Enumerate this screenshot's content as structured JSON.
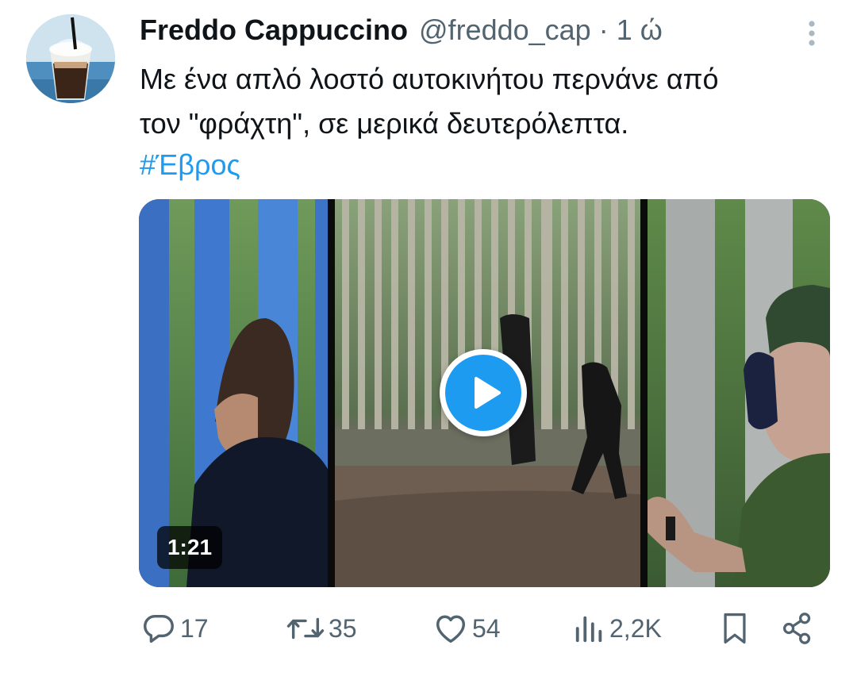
{
  "tweet": {
    "display_name": "Freddo Cappuccino",
    "handle": "@freddo_cap",
    "separator": "·",
    "time": "1 ώ",
    "text_lines": [
      "Με ένα απλό λοστό αυτοκινήτου περνάνε από",
      "τον \"φράχτη\", σε μερικά δευτερόλεπτα."
    ],
    "hashtag": "#Έβρος"
  },
  "media": {
    "type": "video",
    "duration": "1:21",
    "play_icon": "play-icon"
  },
  "actions": {
    "replies": "17",
    "retweets": "35",
    "likes": "54",
    "views": "2,2K"
  },
  "icons": {
    "reply": "reply-icon",
    "retweet": "retweet-icon",
    "like": "heart-icon",
    "views": "views-icon",
    "bookmark": "bookmark-icon",
    "share": "share-icon",
    "more": "more-vertical-icon"
  },
  "colors": {
    "accent": "#1d9bf0",
    "text_primary": "#0f1419",
    "text_secondary": "#536471"
  }
}
